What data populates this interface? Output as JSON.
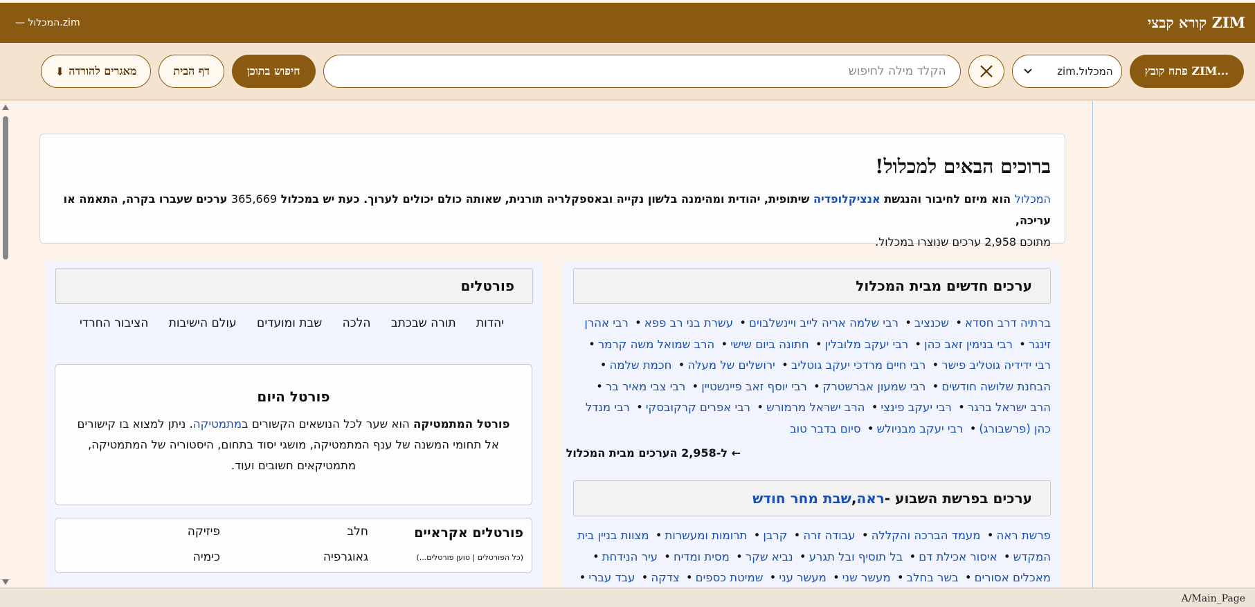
{
  "titlebar": {
    "app_title": "קורא קבצי ZIM",
    "file_indicator": "— המכלול.zim"
  },
  "toolbar": {
    "open_zim_label": "פתח קובץ ZIM...",
    "file_select_value": "המכלול.zim",
    "search_placeholder": "הקלד מילה לחיפוש",
    "search_content_label": "חיפוש בתוכן",
    "home_label": "דף הבית",
    "downloads_label": "מאגרים להורדה"
  },
  "welcome": {
    "title": "ברוכים הבאים למכלול!",
    "p1_link1": "המכלול",
    "p1_text1": " הוא מיזם לחיבור והנגשת ",
    "p1_link2": "אנציקלופדיה",
    "p1_text2": " שיתופית, יהודית ומהימנה בלשון נקייה ובאספקלריה תורנית, שאותה כולם יכולים לערוך. כעת יש במכלול ",
    "p1_count": "365,669",
    "p1_text3": " ערכים שעברו בקרה, התאמה או עריכה,",
    "p1_text4": "מתוכם 2,958 ערכים שנוצרו במכלול."
  },
  "new_articles": {
    "title": "ערכים חדשים מבית המכלול",
    "links": [
      "ברתיה דרב חסדא",
      "שכנציב",
      "רבי שלמה אריה לייב ויינשלבוים",
      "עשרת בני רב פפא",
      "רבי אהרן זינגר",
      "רבי בנימין זאב כהן",
      "רבי יעקב מלובלין",
      "חתונה ביום שישי",
      "הרב שמואל משה קרמר",
      "רבי ידידיה גוטליב פישר",
      "רבי חיים מרדכי יעקב גוטליב",
      "ירושלים של מעלה",
      "חכמת שלמה",
      "הבחנת שלושה חודשים",
      "רבי שמעון אברשטרק",
      "רבי יוסף זאב פיינשטיין",
      "רבי צבי מאיר בר",
      "הרב ישראל ברגר",
      "רבי יעקב פינצי",
      "הרב ישראל מרמורש",
      "רבי אפרים קרקובסקי",
      "רבי מנדל כהן (פרשבורג)",
      "רבי יעקב מבניולש",
      "סיום בדבר טוב"
    ],
    "more_link": "← ל-2,958 הערכים מבית המכלול"
  },
  "parsha": {
    "title_prefix": "ערכים בפרשת השבוע - ",
    "title_link1": "ראה",
    "title_comma": ", ",
    "title_link2": "שבת מחר חודש",
    "links": [
      "פרשת ראה",
      "מעמד הברכה והקללה",
      "עבודה זרה",
      "קרבן",
      "תרומות ומעשרות",
      "מצוות בניין בית המקדש",
      "איסור אכילת דם",
      "בל תוסיף ובל תגרע",
      "נביא שקר",
      "מסית ומדיח",
      "עיר הנידחת",
      "מאכלים אסורים",
      "בשר בחלב",
      "מעשר שני",
      "מעשר עני",
      "שמיטת כספים",
      "צדקה",
      "עבד עברי"
    ]
  },
  "portals": {
    "title": "פורטלים",
    "categories": [
      "יהדות",
      "תורה שבכתב",
      "הלכה",
      "שבת ומועדים",
      "עולם הישיבות",
      "הציבור החרדי"
    ],
    "today_title": "פורטל היום",
    "today_bold": "פורטל המתמטיקה",
    "today_text1": " הוא שער לכל הנושאים הקשורים ב",
    "today_link": "מתמטיקה",
    "today_text2": ". ניתן למצוא בו קישורים אל תחומי המשנה של ענף המתמטיקה, מושגי יסוד בתחום, היסטוריה של המתמטיקה, מתמטיקאים חשובים ועוד.",
    "random_title": "פורטלים אקראיים",
    "random_sub": "(כל הפורטלים | טוען פורטלים...)",
    "random_items": [
      "חלב",
      "פיזיקה",
      "גאוגרפיה",
      "כימיה"
    ]
  },
  "statusbar": {
    "url": "A/Main_Page"
  }
}
